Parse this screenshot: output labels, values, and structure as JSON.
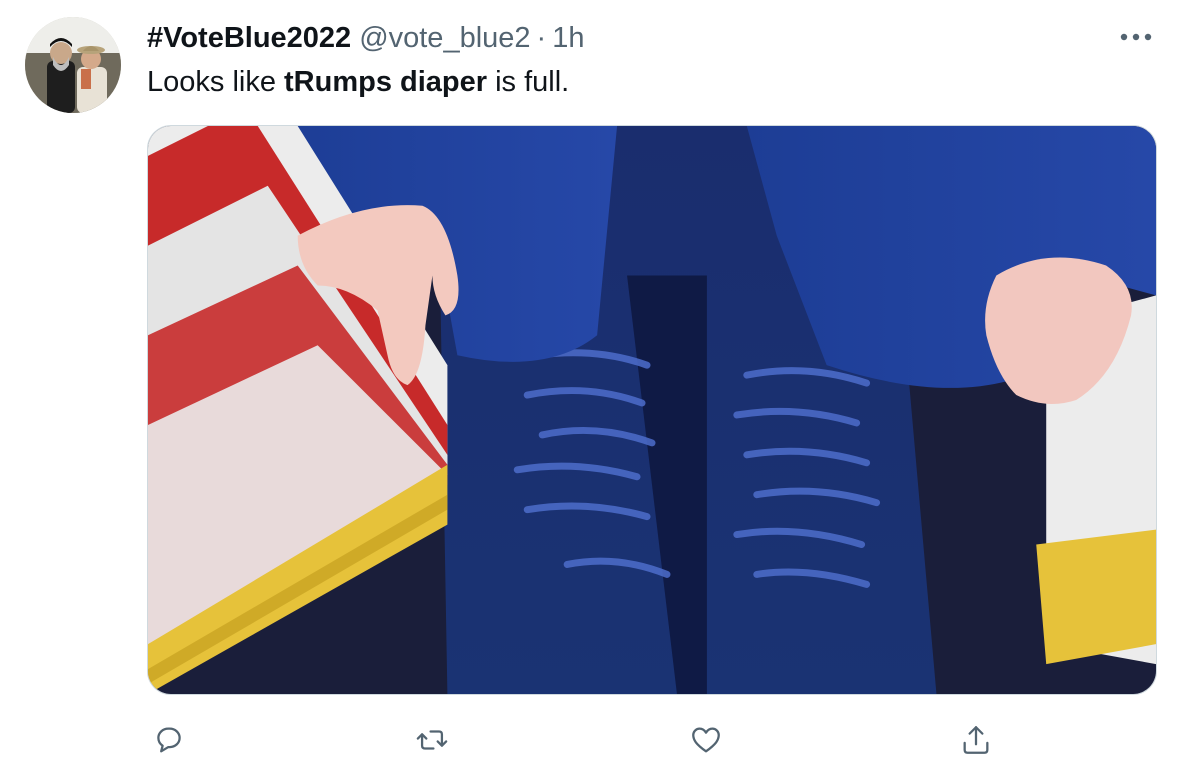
{
  "tweet": {
    "display_name": "#VoteBlue2022",
    "handle": "@vote_blue2",
    "separator": "·",
    "timestamp": "1h",
    "text_before": "Looks like ",
    "text_bold": "tRumps diaper",
    "text_after": " is full."
  },
  "icons": {
    "more": "more-horizontal-icon",
    "reply": "reply-icon",
    "retweet": "retweet-icon",
    "like": "heart-icon",
    "share": "share-icon"
  },
  "colors": {
    "text": "#0f1419",
    "secondary": "#536471",
    "border": "#cfd9de",
    "suit_blue": "#1f3f96",
    "flag_red": "#c72a2a",
    "fringe_gold": "#e6c23a"
  }
}
